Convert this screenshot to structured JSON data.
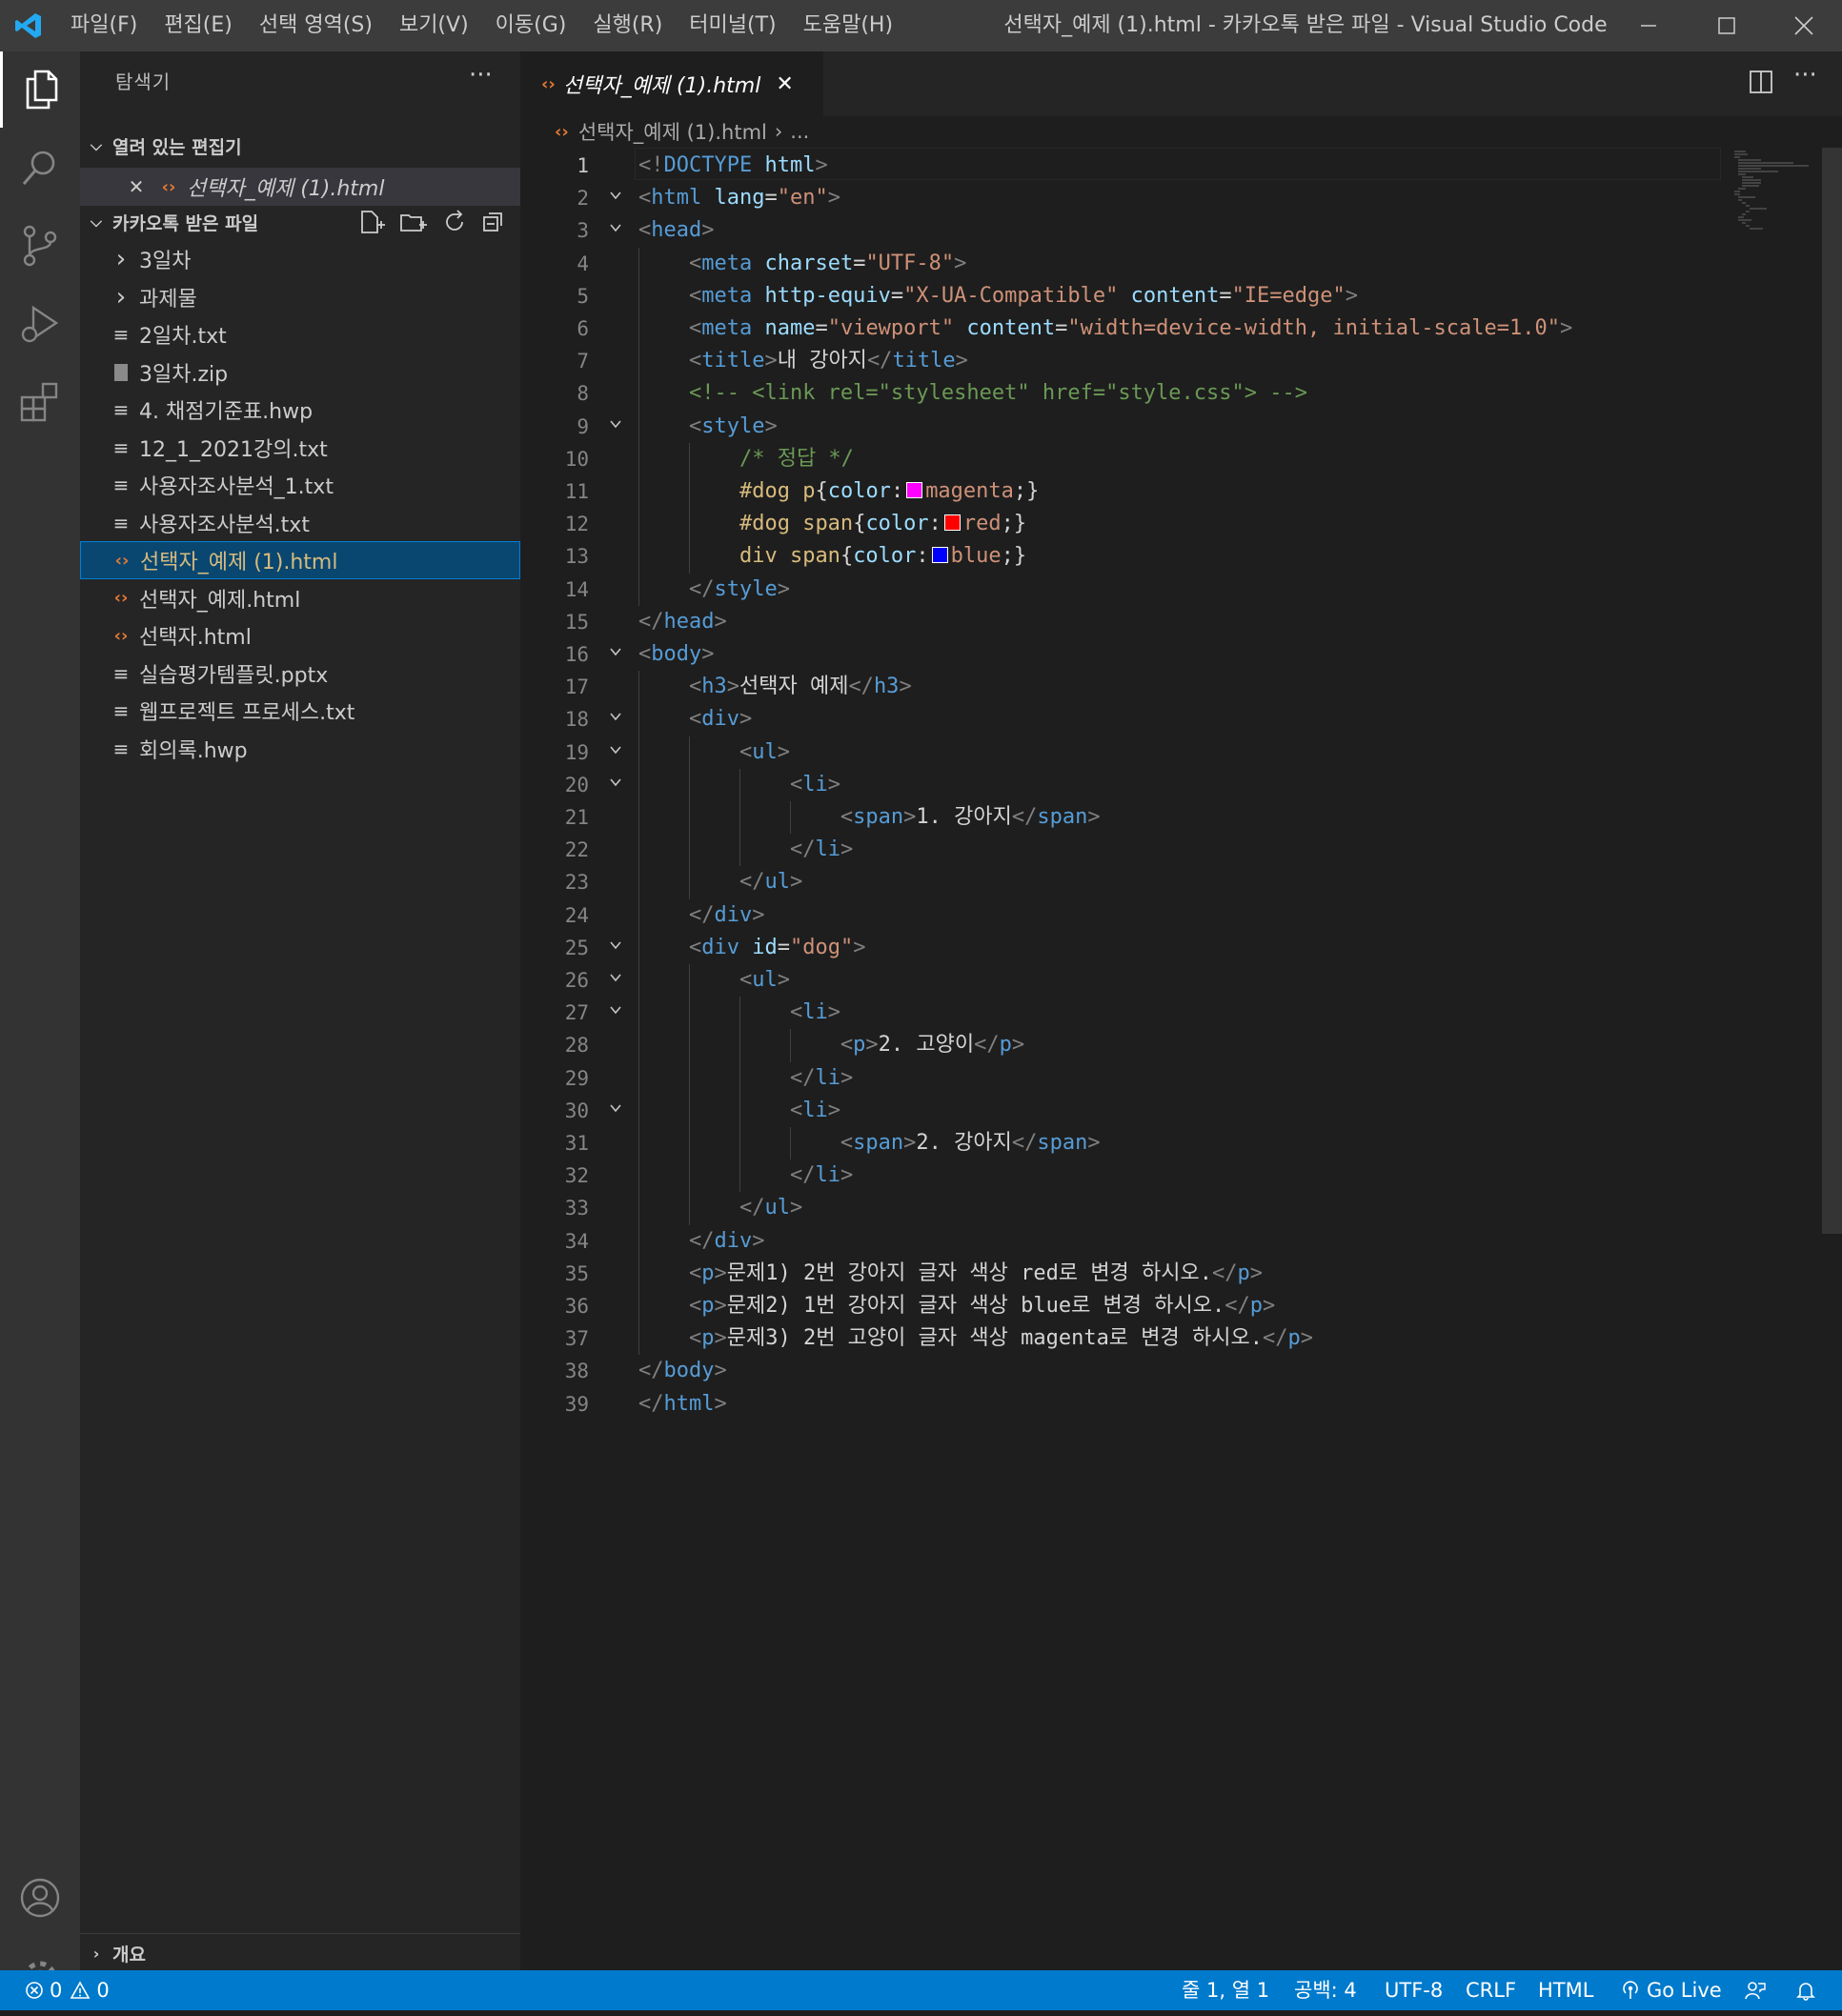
{
  "titlebar": {
    "menus": [
      "파일(F)",
      "편집(E)",
      "선택 영역(S)",
      "보기(V)",
      "이동(G)",
      "실행(R)",
      "터미널(T)",
      "도움말(H)"
    ],
    "title": "선택자_예제 (1).html - 카카오톡 받은 파일 - Visual Studio Code"
  },
  "sidebar": {
    "title": "탐색기",
    "open_editors": {
      "header": "열려 있는 편집기",
      "items": [
        {
          "label": "선택자_예제 (1).html"
        }
      ]
    },
    "folder": {
      "header": "카카오톡 받은 파일",
      "items": [
        {
          "label": "3일차",
          "kind": "folder"
        },
        {
          "label": "과제물",
          "kind": "folder"
        },
        {
          "label": "2일차.txt",
          "kind": "text"
        },
        {
          "label": "3일차.zip",
          "kind": "zip"
        },
        {
          "label": "4. 채점기준표.hwp",
          "kind": "text"
        },
        {
          "label": "12_1_2021강의.txt",
          "kind": "text"
        },
        {
          "label": "사용자조사분석_1.txt",
          "kind": "text"
        },
        {
          "label": "사용자조사분석.txt",
          "kind": "text"
        },
        {
          "label": "선택자_예제 (1).html",
          "kind": "html",
          "selected": true
        },
        {
          "label": "선택자_예제.html",
          "kind": "html"
        },
        {
          "label": "선택자.html",
          "kind": "html"
        },
        {
          "label": "실습평가템플릿.pptx",
          "kind": "text"
        },
        {
          "label": "웹프로젝트 프로세스.txt",
          "kind": "text"
        },
        {
          "label": "회의록.hwp",
          "kind": "text"
        }
      ]
    },
    "outline": {
      "header": "개요"
    }
  },
  "editor": {
    "tab_label": "선택자_예제 (1).html",
    "breadcrumb": {
      "file": "선택자_예제 (1).html",
      "rest": "..."
    },
    "current_line": 1,
    "folding_lines": [
      2,
      3,
      9,
      16,
      18,
      19,
      20,
      25,
      26,
      27,
      30
    ],
    "lines": [
      [
        [
          "t",
          "<!"
        ],
        [
          "n",
          "DOCTYPE"
        ],
        [
          "tx",
          " "
        ],
        [
          "a",
          "html"
        ],
        [
          "t",
          ">"
        ]
      ],
      [
        [
          "t",
          "<"
        ],
        [
          "n",
          "html"
        ],
        [
          "tx",
          " "
        ],
        [
          "a",
          "lang"
        ],
        [
          "tx",
          "="
        ],
        [
          "s",
          "\"en\""
        ],
        [
          "t",
          ">"
        ]
      ],
      [
        [
          "t",
          "<"
        ],
        [
          "n",
          "head"
        ],
        [
          "t",
          ">"
        ]
      ],
      [
        [
          "tx",
          "    "
        ],
        [
          "t",
          "<"
        ],
        [
          "n",
          "meta"
        ],
        [
          "tx",
          " "
        ],
        [
          "a",
          "charset"
        ],
        [
          "tx",
          "="
        ],
        [
          "s",
          "\"UTF-8\""
        ],
        [
          "t",
          ">"
        ]
      ],
      [
        [
          "tx",
          "    "
        ],
        [
          "t",
          "<"
        ],
        [
          "n",
          "meta"
        ],
        [
          "tx",
          " "
        ],
        [
          "a",
          "http-equiv"
        ],
        [
          "tx",
          "="
        ],
        [
          "s",
          "\"X-UA-Compatible\""
        ],
        [
          "tx",
          " "
        ],
        [
          "a",
          "content"
        ],
        [
          "tx",
          "="
        ],
        [
          "s",
          "\"IE=edge\""
        ],
        [
          "t",
          ">"
        ]
      ],
      [
        [
          "tx",
          "    "
        ],
        [
          "t",
          "<"
        ],
        [
          "n",
          "meta"
        ],
        [
          "tx",
          " "
        ],
        [
          "a",
          "name"
        ],
        [
          "tx",
          "="
        ],
        [
          "s",
          "\"viewport\""
        ],
        [
          "tx",
          " "
        ],
        [
          "a",
          "content"
        ],
        [
          "tx",
          "="
        ],
        [
          "s",
          "\"width=device-width, initial-scale=1.0\""
        ],
        [
          "t",
          ">"
        ]
      ],
      [
        [
          "tx",
          "    "
        ],
        [
          "t",
          "<"
        ],
        [
          "n",
          "title"
        ],
        [
          "t",
          ">"
        ],
        [
          "tx",
          "내 강아지"
        ],
        [
          "t",
          "</"
        ],
        [
          "n",
          "title"
        ],
        [
          "t",
          ">"
        ]
      ],
      [
        [
          "tx",
          "    "
        ],
        [
          "c",
          "<!-- <link rel=\"stylesheet\" href=\"style.css\"> -->"
        ]
      ],
      [
        [
          "tx",
          "    "
        ],
        [
          "t",
          "<"
        ],
        [
          "n",
          "style"
        ],
        [
          "t",
          ">"
        ]
      ],
      [
        [
          "tx",
          "        "
        ],
        [
          "c",
          "/* 정답 */"
        ]
      ],
      [
        [
          "tx",
          "        "
        ],
        [
          "sel",
          "#dog p"
        ],
        [
          "tx",
          "{"
        ],
        [
          "p",
          "color"
        ],
        [
          "tx",
          ":"
        ],
        [
          "sw",
          "#ff00ff"
        ],
        [
          "v",
          "magenta"
        ],
        [
          "tx",
          ";}"
        ]
      ],
      [
        [
          "tx",
          "        "
        ],
        [
          "sel",
          "#dog span"
        ],
        [
          "tx",
          "{"
        ],
        [
          "p",
          "color"
        ],
        [
          "tx",
          ":"
        ],
        [
          "sw",
          "#ff0000"
        ],
        [
          "v",
          "red"
        ],
        [
          "tx",
          ";}"
        ]
      ],
      [
        [
          "tx",
          "        "
        ],
        [
          "sel",
          "div span"
        ],
        [
          "tx",
          "{"
        ],
        [
          "p",
          "color"
        ],
        [
          "tx",
          ":"
        ],
        [
          "sw",
          "#0000ff"
        ],
        [
          "v",
          "blue"
        ],
        [
          "tx",
          ";}"
        ]
      ],
      [
        [
          "tx",
          "    "
        ],
        [
          "t",
          "</"
        ],
        [
          "n",
          "style"
        ],
        [
          "t",
          ">"
        ]
      ],
      [
        [
          "t",
          "</"
        ],
        [
          "n",
          "head"
        ],
        [
          "t",
          ">"
        ]
      ],
      [
        [
          "t",
          "<"
        ],
        [
          "n",
          "body"
        ],
        [
          "t",
          ">"
        ]
      ],
      [
        [
          "tx",
          "    "
        ],
        [
          "t",
          "<"
        ],
        [
          "n",
          "h3"
        ],
        [
          "t",
          ">"
        ],
        [
          "tx",
          "선택자 예제"
        ],
        [
          "t",
          "</"
        ],
        [
          "n",
          "h3"
        ],
        [
          "t",
          ">"
        ]
      ],
      [
        [
          "tx",
          "    "
        ],
        [
          "t",
          "<"
        ],
        [
          "n",
          "div"
        ],
        [
          "t",
          ">"
        ]
      ],
      [
        [
          "tx",
          "        "
        ],
        [
          "t",
          "<"
        ],
        [
          "n",
          "ul"
        ],
        [
          "t",
          ">"
        ]
      ],
      [
        [
          "tx",
          "            "
        ],
        [
          "t",
          "<"
        ],
        [
          "n",
          "li"
        ],
        [
          "t",
          ">"
        ]
      ],
      [
        [
          "tx",
          "                "
        ],
        [
          "t",
          "<"
        ],
        [
          "n",
          "span"
        ],
        [
          "t",
          ">"
        ],
        [
          "tx",
          "1. 강아지"
        ],
        [
          "t",
          "</"
        ],
        [
          "n",
          "span"
        ],
        [
          "t",
          ">"
        ]
      ],
      [
        [
          "tx",
          "            "
        ],
        [
          "t",
          "</"
        ],
        [
          "n",
          "li"
        ],
        [
          "t",
          ">"
        ]
      ],
      [
        [
          "tx",
          "        "
        ],
        [
          "t",
          "</"
        ],
        [
          "n",
          "ul"
        ],
        [
          "t",
          ">"
        ]
      ],
      [
        [
          "tx",
          "    "
        ],
        [
          "t",
          "</"
        ],
        [
          "n",
          "div"
        ],
        [
          "t",
          ">"
        ]
      ],
      [
        [
          "tx",
          "    "
        ],
        [
          "t",
          "<"
        ],
        [
          "n",
          "div"
        ],
        [
          "tx",
          " "
        ],
        [
          "a",
          "id"
        ],
        [
          "tx",
          "="
        ],
        [
          "s",
          "\"dog\""
        ],
        [
          "t",
          ">"
        ]
      ],
      [
        [
          "tx",
          "        "
        ],
        [
          "t",
          "<"
        ],
        [
          "n",
          "ul"
        ],
        [
          "t",
          ">"
        ]
      ],
      [
        [
          "tx",
          "            "
        ],
        [
          "t",
          "<"
        ],
        [
          "n",
          "li"
        ],
        [
          "t",
          ">"
        ]
      ],
      [
        [
          "tx",
          "                "
        ],
        [
          "t",
          "<"
        ],
        [
          "n",
          "p"
        ],
        [
          "t",
          ">"
        ],
        [
          "tx",
          "2. 고양이"
        ],
        [
          "t",
          "</"
        ],
        [
          "n",
          "p"
        ],
        [
          "t",
          ">"
        ]
      ],
      [
        [
          "tx",
          "            "
        ],
        [
          "t",
          "</"
        ],
        [
          "n",
          "li"
        ],
        [
          "t",
          ">"
        ]
      ],
      [
        [
          "tx",
          "            "
        ],
        [
          "t",
          "<"
        ],
        [
          "n",
          "li"
        ],
        [
          "t",
          ">"
        ]
      ],
      [
        [
          "tx",
          "                "
        ],
        [
          "t",
          "<"
        ],
        [
          "n",
          "span"
        ],
        [
          "t",
          ">"
        ],
        [
          "tx",
          "2. 강아지"
        ],
        [
          "t",
          "</"
        ],
        [
          "n",
          "span"
        ],
        [
          "t",
          ">"
        ]
      ],
      [
        [
          "tx",
          "            "
        ],
        [
          "t",
          "</"
        ],
        [
          "n",
          "li"
        ],
        [
          "t",
          ">"
        ]
      ],
      [
        [
          "tx",
          "        "
        ],
        [
          "t",
          "</"
        ],
        [
          "n",
          "ul"
        ],
        [
          "t",
          ">"
        ]
      ],
      [
        [
          "tx",
          "    "
        ],
        [
          "t",
          "</"
        ],
        [
          "n",
          "div"
        ],
        [
          "t",
          ">"
        ]
      ],
      [
        [
          "tx",
          "    "
        ],
        [
          "t",
          "<"
        ],
        [
          "n",
          "p"
        ],
        [
          "t",
          ">"
        ],
        [
          "tx",
          "문제1) 2번 강아지 글자 색상 red로 변경 하시오."
        ],
        [
          "t",
          "</"
        ],
        [
          "n",
          "p"
        ],
        [
          "t",
          ">"
        ]
      ],
      [
        [
          "tx",
          "    "
        ],
        [
          "t",
          "<"
        ],
        [
          "n",
          "p"
        ],
        [
          "t",
          ">"
        ],
        [
          "tx",
          "문제2) 1번 강아지 글자 색상 blue로 변경 하시오."
        ],
        [
          "t",
          "</"
        ],
        [
          "n",
          "p"
        ],
        [
          "t",
          ">"
        ]
      ],
      [
        [
          "tx",
          "    "
        ],
        [
          "t",
          "<"
        ],
        [
          "n",
          "p"
        ],
        [
          "t",
          ">"
        ],
        [
          "tx",
          "문제3) 2번 고양이 글자 색상 magenta로 변경 하시오."
        ],
        [
          "t",
          "</"
        ],
        [
          "n",
          "p"
        ],
        [
          "t",
          ">"
        ]
      ],
      [
        [
          "t",
          "</"
        ],
        [
          "n",
          "body"
        ],
        [
          "t",
          ">"
        ]
      ],
      [
        [
          "t",
          "</"
        ],
        [
          "n",
          "html"
        ],
        [
          "t",
          ">"
        ]
      ]
    ]
  },
  "statusbar": {
    "errors": "0",
    "warnings": "0",
    "position": "줄 1, 열 1",
    "spaces": "공백: 4",
    "encoding": "UTF-8",
    "eol": "CRLF",
    "language": "HTML",
    "golive": "Go Live"
  },
  "colors": {
    "accent": "#007acc",
    "selection": "#094771",
    "html_icon": "#e37933"
  }
}
